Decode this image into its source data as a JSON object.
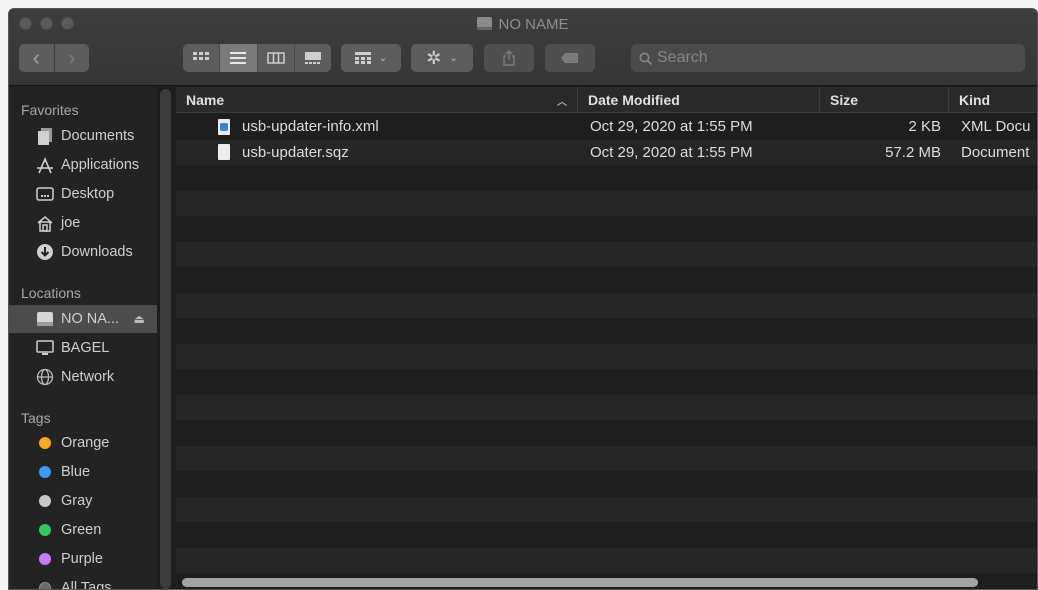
{
  "window": {
    "title": "NO NAME"
  },
  "toolbar": {
    "back_glyph": "‹",
    "forward_glyph": "›",
    "search_placeholder": "Search"
  },
  "sidebar": {
    "favorites_header": "Favorites",
    "favorites": [
      {
        "label": "Documents",
        "icon": "documents-icon"
      },
      {
        "label": "Applications",
        "icon": "applications-icon"
      },
      {
        "label": "Desktop",
        "icon": "desktop-icon"
      },
      {
        "label": "joe",
        "icon": "home-icon"
      },
      {
        "label": "Downloads",
        "icon": "downloads-icon"
      }
    ],
    "locations_header": "Locations",
    "locations": [
      {
        "label": "NO NA...",
        "icon": "drive-icon",
        "selected": true
      },
      {
        "label": "BAGEL",
        "icon": "computer-icon"
      },
      {
        "label": "Network",
        "icon": "network-icon"
      }
    ],
    "tags_header": "Tags",
    "tags": [
      {
        "label": "Orange",
        "color": "#f5a623"
      },
      {
        "label": "Blue",
        "color": "#3b99fc"
      },
      {
        "label": "Gray",
        "color": "#c8c8c8"
      },
      {
        "label": "Green",
        "color": "#34c759"
      },
      {
        "label": "Purple",
        "color": "#c77dff"
      },
      {
        "label": "All Tags...",
        "color": "#6b6b6b"
      }
    ]
  },
  "columns": {
    "name": "Name",
    "date": "Date Modified",
    "size": "Size",
    "kind": "Kind"
  },
  "files": [
    {
      "name": "usb-updater-info.xml",
      "date": "Oct 29, 2020 at 1:55 PM",
      "size": "2 KB",
      "kind": "XML Docu",
      "icon": "xml-file-icon"
    },
    {
      "name": "usb-updater.sqz",
      "date": "Oct 29, 2020 at 1:55 PM",
      "size": "57.2 MB",
      "kind": "Document",
      "icon": "document-file-icon"
    }
  ]
}
